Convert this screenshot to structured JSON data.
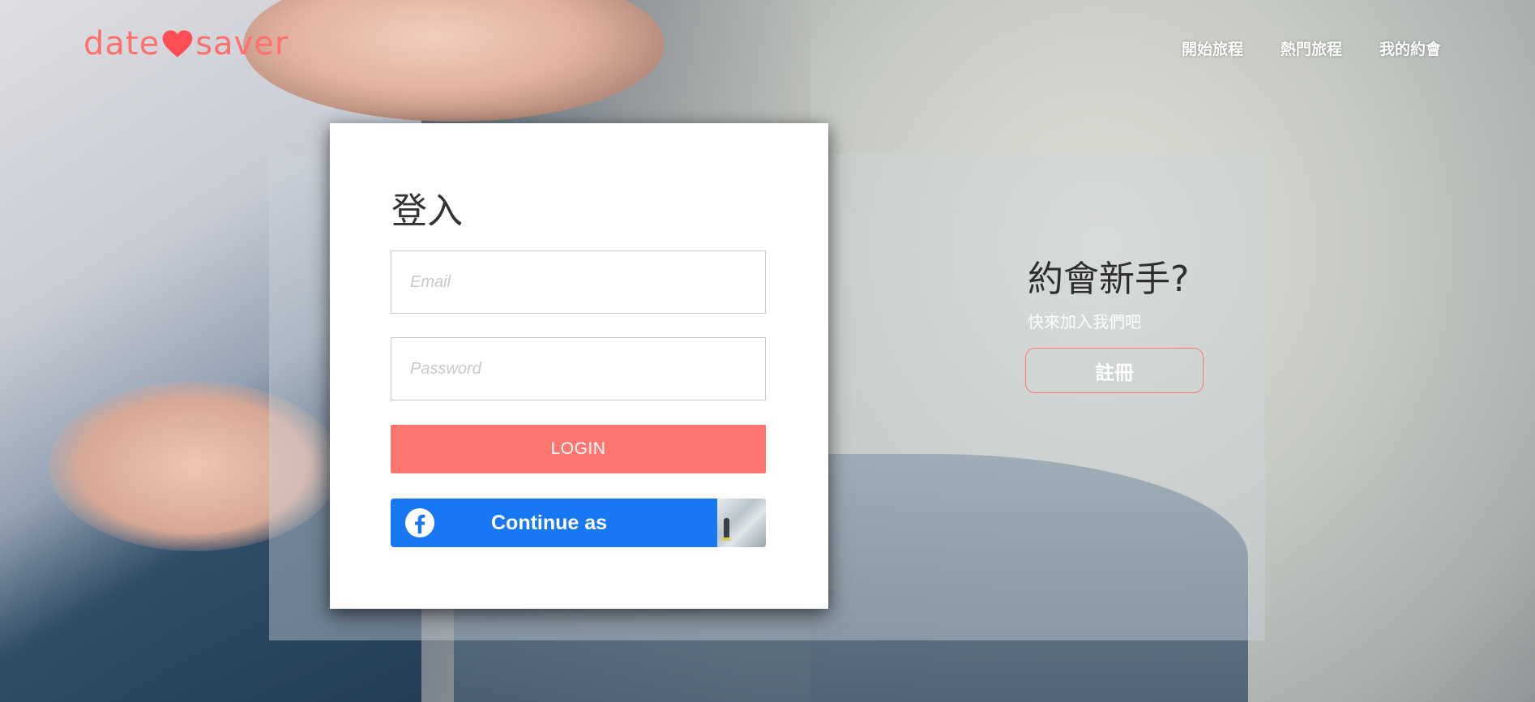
{
  "header": {
    "logo_left": "date",
    "logo_right": "saver",
    "nav": [
      "開始旅程",
      "熱門旅程",
      "我的約會"
    ]
  },
  "login": {
    "title": "登入",
    "email_placeholder": "Email",
    "password_placeholder": "Password",
    "login_label": "LOGIN",
    "facebook_label": "Continue as"
  },
  "signup": {
    "title": "約會新手?",
    "subtitle": "快來加入我們吧",
    "button_label": "註冊"
  },
  "colors": {
    "accent": "#ff7670",
    "facebook": "#1877f2"
  },
  "icons": {
    "logo_heart": "heart-icon",
    "facebook": "facebook-icon"
  }
}
